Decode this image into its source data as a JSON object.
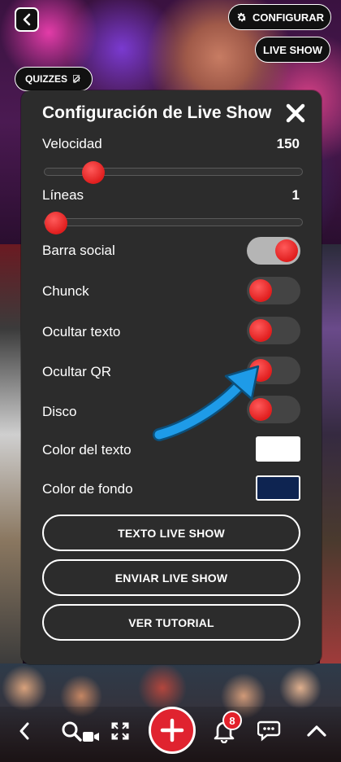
{
  "top": {
    "configure_label": "CONFIGURAR",
    "live_show_label": "LIVE SHOW",
    "quizzes_label": "QUIZZES"
  },
  "modal": {
    "title": "Configuración de Live Show",
    "speed": {
      "label": "Velocidad",
      "value": "150",
      "fraction": 0.16
    },
    "lines": {
      "label": "Líneas",
      "value": "1",
      "fraction": 0.0
    },
    "toggles": [
      {
        "label": "Barra social",
        "on": true
      },
      {
        "label": "Chunck",
        "on": false
      },
      {
        "label": "Ocultar texto",
        "on": false
      },
      {
        "label": "Ocultar QR",
        "on": false
      },
      {
        "label": "Disco",
        "on": false
      }
    ],
    "text_color": {
      "label": "Color del texto",
      "color": "#ffffff"
    },
    "bg_color": {
      "label": "Color de fondo",
      "color": "#0e2451"
    },
    "buttons": {
      "text_live_show": "TEXTO LIVE SHOW",
      "send_live_show": "ENVIAR LIVE SHOW",
      "tutorial": "VER TUTORIAL"
    }
  },
  "bottom": {
    "notification_count": "8"
  },
  "colors": {
    "accent_red": "#e01e1e",
    "modal_bg": "#2c2c2c",
    "arrow_blue": "#1e9be8"
  },
  "icons": {
    "back": "chevron-left-icon",
    "configure": "gear-icon",
    "quizzes": "edit-icon",
    "close": "close-icon",
    "nav": [
      "chevron-left-icon",
      "search-icon",
      "fullscreen-icon",
      "plus-icon",
      "bell-icon",
      "chat-icon",
      "chevron-up-icon"
    ]
  }
}
